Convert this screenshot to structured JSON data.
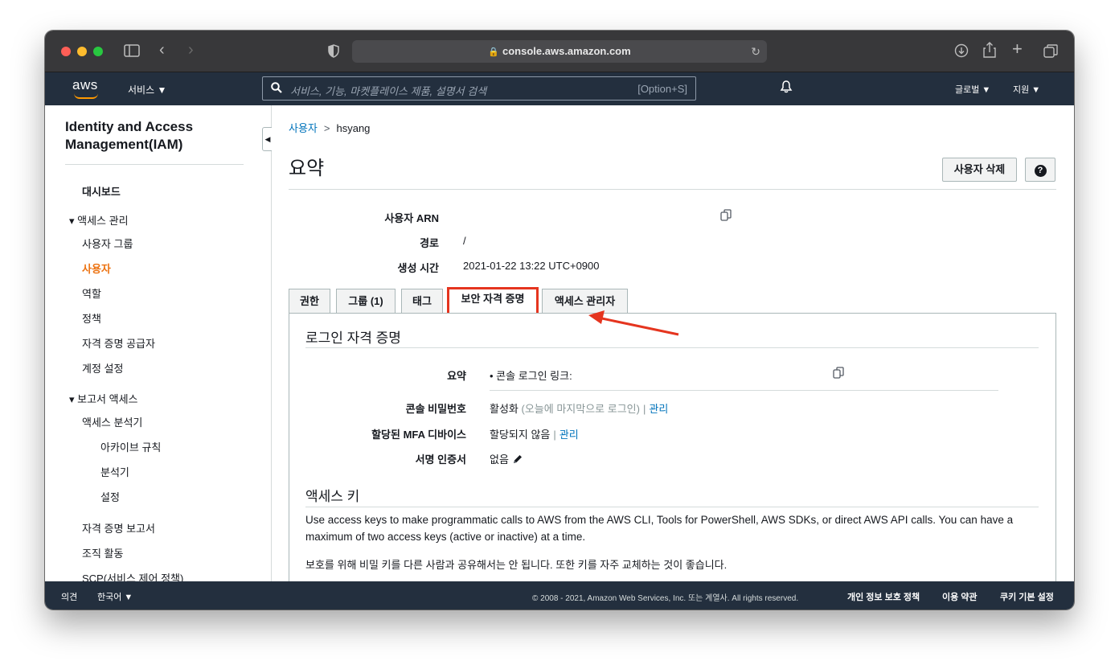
{
  "browser": {
    "url": "console.aws.amazon.com"
  },
  "awsnav": {
    "logo": "aws",
    "services_label": "서비스 ▼",
    "search_placeholder": "서비스, 기능, 마켓플레이스 제품, 설명서 검색",
    "search_shortcut": "[Option+S]",
    "region_label": "글로벌 ▼",
    "support_label": "지원 ▼"
  },
  "sidebar": {
    "title": "Identity and Access Management(IAM)",
    "dashboard": "대시보드",
    "access_mgmt": "▾ 액세스 관리",
    "items_access": [
      "사용자 그룹",
      "사용자",
      "역할",
      "정책",
      "자격 증명 공급자",
      "계정 설정"
    ],
    "report_access": "▾ 보고서 액세스",
    "analyzer": "액세스 분석기",
    "analyzer_sub": [
      "아카이브 규칙",
      "분석기",
      "설정"
    ],
    "items_report": [
      "자격 증명 보고서",
      "조직 활동",
      "SCP(서비스 제어 정책)"
    ]
  },
  "main": {
    "breadcrumb_parent": "사용자",
    "breadcrumb_sep": ">",
    "breadcrumb_current": "hsyang",
    "title": "요약",
    "delete_button": "사용자 삭제",
    "help_button": "?",
    "summary": {
      "arn_label": "사용자 ARN",
      "path_label": "경로",
      "path_value": "/",
      "created_label": "생성 시간",
      "created_value": "2021-01-22 13:22 UTC+0900"
    },
    "tabs": [
      "권한",
      "그룹 (1)",
      "태그",
      "보안 자격 증명",
      "액세스 관리자"
    ],
    "login_section": {
      "title": "로그인 자격 증명",
      "summary_label": "요약",
      "summary_value": "•  콘솔 로그인 링크:",
      "password_label": "콘솔 비밀번호",
      "password_value": "활성화",
      "password_note": "(오늘에 마지막으로 로그인)",
      "manage_link": "관리",
      "mfa_label": "할당된 MFA 디바이스",
      "mfa_value": "할당되지 않음",
      "cert_label": "서명 인증서",
      "cert_value": "없음"
    },
    "access_keys": {
      "title": "액세스 키",
      "description": "Use access keys to make programmatic calls to AWS from the AWS CLI, Tools for PowerShell, AWS SDKs, or direct AWS API calls. You can have a maximum of two access keys (active or inactive) at a time.",
      "warning": "보호를 위해 비밀 키를 다른 사람과 공유해서는 안 됩니다. 또한 키를 자주 교체하는 것이 좋습니다."
    }
  },
  "footer": {
    "feedback": "의견",
    "language": "한국어 ▼",
    "copyright": "© 2008 - 2021, Amazon Web Services, Inc. 또는 계열사. All rights reserved.",
    "privacy": "개인 정보 보호 정책",
    "terms": "이용 약관",
    "cookies": "쿠키 기본 설정"
  },
  "colors": {
    "aws_nav": "#232f3e",
    "active_orange": "#ec7211",
    "link_blue": "#0073bb",
    "highlight_red": "#e5351f"
  }
}
